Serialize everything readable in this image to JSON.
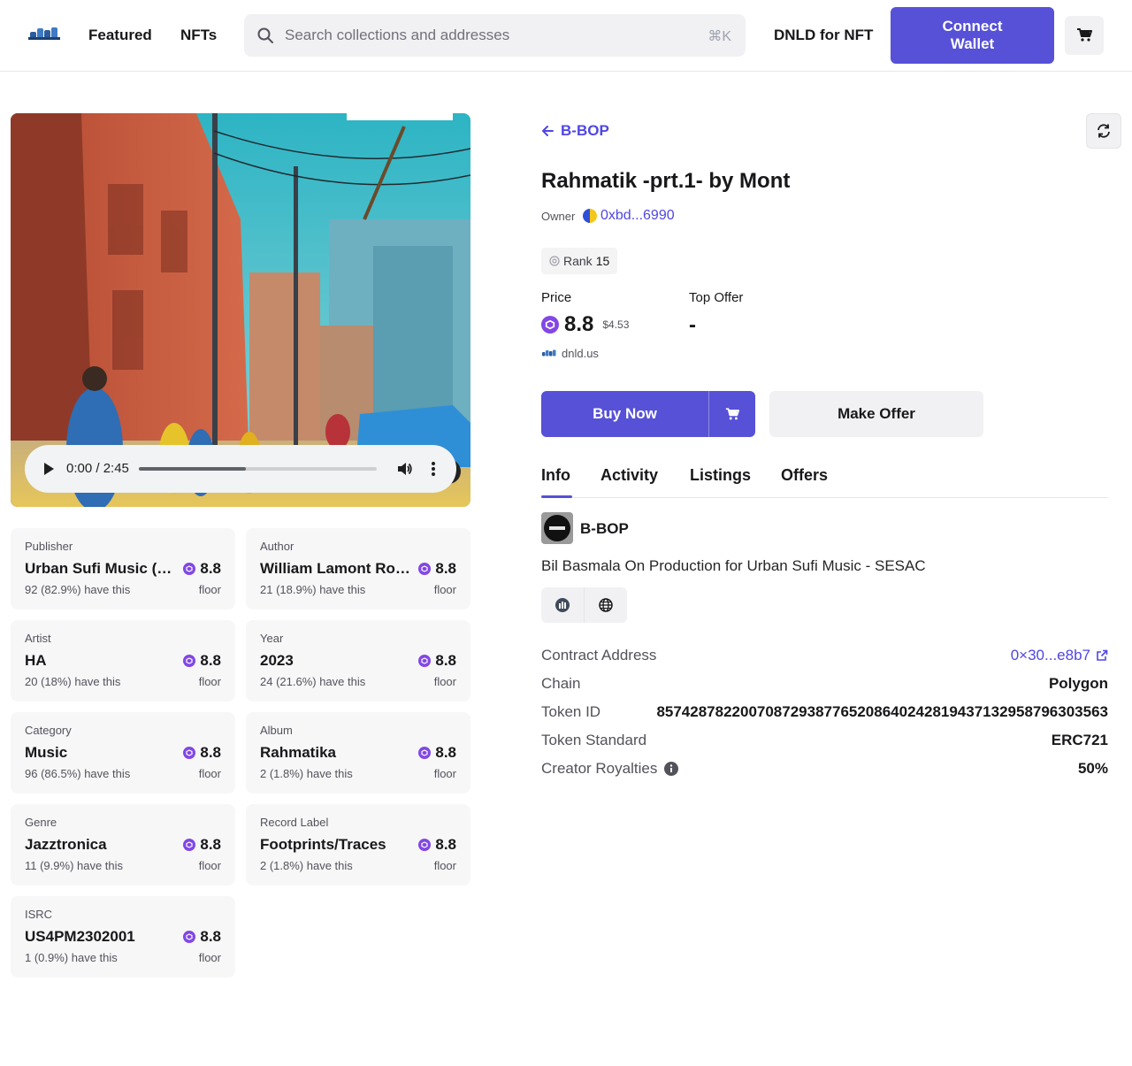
{
  "header": {
    "nav": [
      "Featured",
      "NFTs"
    ],
    "search_placeholder": "Search collections and addresses",
    "search_shortcut": "⌘K",
    "dnld_link": "DNLD for NFT",
    "connect_label": "Connect Wallet"
  },
  "player": {
    "time": "0:00 / 2:45",
    "progress": 0.45
  },
  "traits": [
    {
      "label": "Publisher",
      "value": "Urban Sufi Music (SESAC)",
      "price": "8.8",
      "count": "92 (82.9%) have this",
      "floor": "floor"
    },
    {
      "label": "Author",
      "value": "William Lamont Roberts",
      "price": "8.8",
      "count": "21 (18.9%) have this",
      "floor": "floor"
    },
    {
      "label": "Artist",
      "value": "HA",
      "price": "8.8",
      "count": "20 (18%) have this",
      "floor": "floor"
    },
    {
      "label": "Year",
      "value": "2023",
      "price": "8.8",
      "count": "24 (21.6%) have this",
      "floor": "floor"
    },
    {
      "label": "Category",
      "value": "Music",
      "price": "8.8",
      "count": "96 (86.5%) have this",
      "floor": "floor"
    },
    {
      "label": "Album",
      "value": "Rahmatika",
      "price": "8.8",
      "count": "2 (1.8%) have this",
      "floor": "floor"
    },
    {
      "label": "Genre",
      "value": "Jazztronica",
      "price": "8.8",
      "count": "11 (9.9%) have this",
      "floor": "floor"
    },
    {
      "label": "Record Label",
      "value": "Footprints/Traces",
      "price": "8.8",
      "count": "2 (1.8%) have this",
      "floor": "floor"
    },
    {
      "label": "ISRC",
      "value": "US4PM2302001",
      "price": "8.8",
      "count": "1 (0.9%) have this",
      "floor": "floor"
    }
  ],
  "detail": {
    "collection": "B-BOP",
    "title": "Rahmatik -prt.1- by Mont",
    "owner_label": "Owner",
    "owner_address": "0xbd...6990",
    "rank_label": "Rank",
    "rank_value": "15",
    "price_label": "Price",
    "price_value": "8.8",
    "price_usd": "$4.53",
    "top_offer_label": "Top Offer",
    "top_offer_value": "-",
    "marketplace": "dnld.us",
    "buy_now": "Buy Now",
    "make_offer": "Make Offer"
  },
  "tabs": [
    "Info",
    "Activity",
    "Listings",
    "Offers"
  ],
  "info": {
    "collection_name": "B-BOP",
    "description": "Bil Basmala On Production for Urban Sufi Music - SESAC",
    "rows": [
      {
        "label": "Contract Address",
        "value": "0×30...e8b7"
      },
      {
        "label": "Chain",
        "value": "Polygon"
      },
      {
        "label": "Token ID",
        "value": "857428782200708729387765208640242819437132958796303563"
      },
      {
        "label": "Token Standard",
        "value": "ERC721"
      },
      {
        "label": "Creator Royalties",
        "value": "50%"
      }
    ]
  },
  "colors": {
    "accent": "#5651d6",
    "link": "#4f46e5",
    "polygon": "#8247e5"
  }
}
